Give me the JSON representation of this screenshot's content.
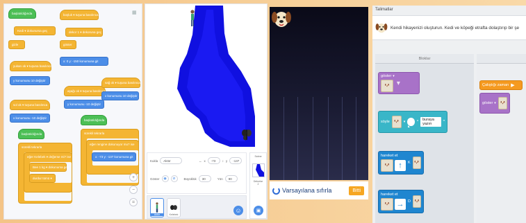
{
  "code_panel": {
    "blocks": [
      {
        "label": "başlatıldığında",
        "kind": "hat-g"
      },
      {
        "label": "Kedi ▾  dokunursa geç",
        "kind": "y"
      },
      {
        "label": "gizle",
        "kind": "y"
      },
      {
        "label": "yukarı ok ▾  tuşuna basılınca",
        "kind": "y"
      },
      {
        "label": "y konumunu  10  değiştir",
        "kind": "b"
      },
      {
        "label": "aşağı ok ▾  tuşuna basılınca",
        "kind": "y"
      },
      {
        "label": "y konumunu  -10  değiştir",
        "kind": "b"
      },
      {
        "label": "sol ok ▾  tuşuna basılınca",
        "kind": "y"
      },
      {
        "label": "x konumunu  -10  değiştir",
        "kind": "b"
      },
      {
        "label": "sağ ok ▾  tuşuna basılınca",
        "kind": "y"
      },
      {
        "label": "x konumunu  10  değiştir",
        "kind": "b"
      },
      {
        "label": "başlatıldığında",
        "kind": "hat-g"
      },
      {
        "label": "sürekli tekrarla",
        "kind": "y"
      },
      {
        "label": "eğer  Kelebek ▾  değerse mi?  ise",
        "kind": "y"
      },
      {
        "label": "Bee 1 kg ▾  dokunursa geç",
        "kind": "y"
      },
      {
        "label": "durdur  tümü ▾",
        "kind": "y"
      },
      {
        "label": "boşluk ▾  tuşuna basılınca",
        "kind": "y"
      },
      {
        "label": "dekor 1 ▾  dekoruna geç",
        "kind": "y"
      },
      {
        "label": "göster",
        "kind": "y"
      },
      {
        "label": "x:  0  y:  -150  konumuna git",
        "kind": "b"
      },
      {
        "label": "başlatıldığında",
        "kind": "hat-g"
      },
      {
        "label": "sürekli tekrarla",
        "kind": "y"
      },
      {
        "label": "eğer  rengine dokunuyor mu?  ise",
        "kind": "y"
      },
      {
        "label": "x:  -73  y:  -137  konumuna git",
        "kind": "b"
      }
    ],
    "zoom": {
      "in": "+",
      "out": "−",
      "reset": "="
    }
  },
  "stage_panel": {
    "props": {
      "sprite_label": "Kukla",
      "sprite_name": "Aktör",
      "x_label": "x",
      "x_value": "-73",
      "y_label": "y",
      "y_value": "-137",
      "show_label": "Göster",
      "size_label": "Büyüklük",
      "size_value": "30",
      "direction_label": "Yön",
      "direction_value": "90"
    },
    "sprites": [
      {
        "name": "Aktör",
        "selected": true
      },
      {
        "name": "Kelebek",
        "selected": false
      }
    ],
    "stage_side_label": "Sahne",
    "backdrops_label": "Dekorlar",
    "backdrops_count": "2"
  },
  "game": {
    "reset_label": "Varsayılana sıfırla",
    "done_label": "Bitti"
  },
  "app": {
    "hint_tab": "Talimatlar",
    "hint_text": "Kendi hikayenizi oluşturun. Kedi ve köpeği etrafta dolaştırıp bir şe",
    "toolbox_title": "Bloklar",
    "blocks": {
      "show": "göster",
      "say": "söyle",
      "say_text": "buraya yazın",
      "move_up": "hareket et",
      "move_up_dir": "K",
      "move_right": "hareket et",
      "move_right_dir": "D",
      "when_run": "Çalıştığı zaman",
      "ws_show": "göster"
    }
  },
  "colors": {
    "path_blue": "#1010e0",
    "scratch_yellow": "#f4b533",
    "scratch_blue": "#4c8ee8",
    "app_purple": "#a872c8",
    "app_teal": "#39b6c8",
    "app_blue": "#1f86d0",
    "app_orange": "#f59a20"
  }
}
